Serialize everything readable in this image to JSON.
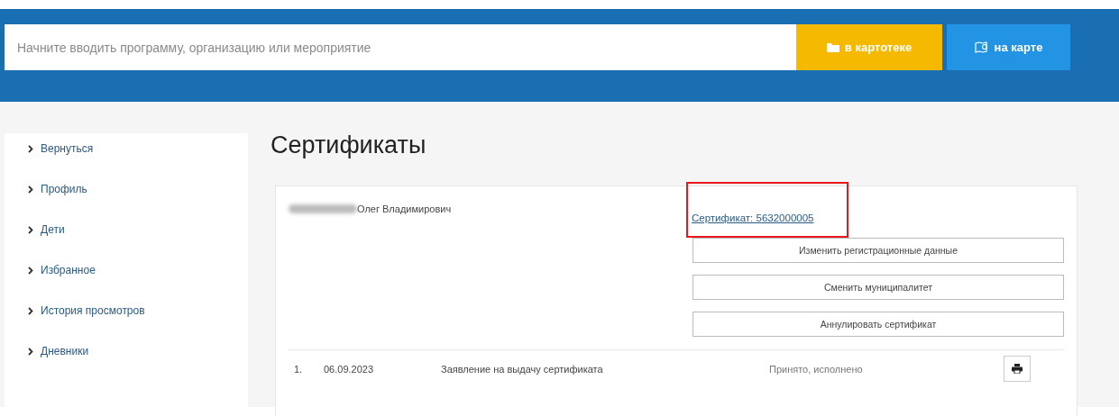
{
  "search": {
    "placeholder": "Начните вводить программу, организацию или мероприятие"
  },
  "header_buttons": [
    {
      "kind": "catalog",
      "label": "в картотеке"
    },
    {
      "kind": "map",
      "label": "на карте"
    }
  ],
  "sidebar": {
    "items": [
      {
        "label": "Вернуться"
      },
      {
        "label": "Профиль"
      },
      {
        "label": "Дети"
      },
      {
        "label": "Избранное"
      },
      {
        "label": "История просмотров"
      },
      {
        "label": "Дневники"
      }
    ]
  },
  "page_title": "Сертификаты",
  "certificate": {
    "holder_name": "Олег Владимирович",
    "link": "Сертификат: 5632000005",
    "highlighted": true,
    "actions": [
      "Изменить регистрационные данные",
      "Сменить муниципалитет",
      "Аннулировать сертификат"
    ],
    "requests": [
      {
        "number": "1.",
        "date": "06.09.2023",
        "title": "Заявление на выдачу сертификата",
        "status": "Принято, исполнено"
      }
    ]
  }
}
